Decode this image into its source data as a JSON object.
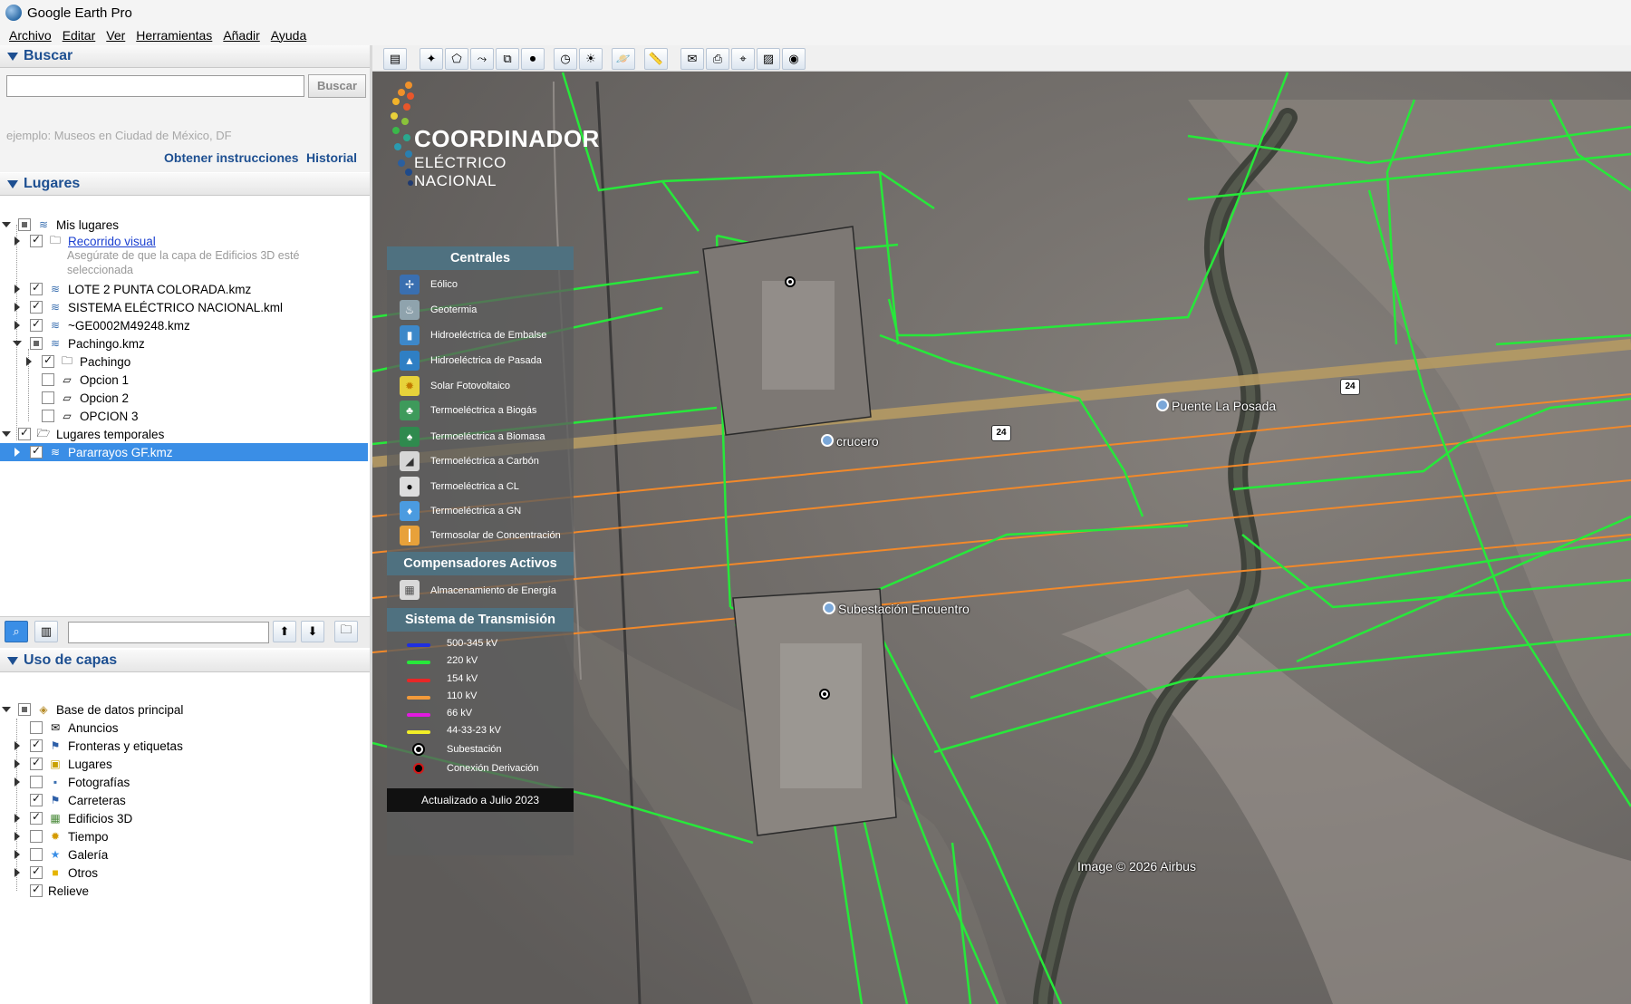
{
  "window": {
    "title": "Google Earth Pro"
  },
  "menu": [
    "Archivo",
    "Editar",
    "Ver",
    "Herramientas",
    "Añadir",
    "Ayuda"
  ],
  "search": {
    "header": "Buscar",
    "input_value": "",
    "button": "Buscar",
    "hint": "ejemplo: Museos en Ciudad de México, DF",
    "directions": "Obtener instrucciones",
    "history": "Historial"
  },
  "places": {
    "header": "Lugares",
    "items": [
      {
        "label": "Mis lugares"
      },
      {
        "label": "Recorrido visual"
      },
      {
        "label": "Asegúrate de que la capa de Edificios 3D esté"
      },
      {
        "label": "seleccionada"
      },
      {
        "label": "LOTE 2 PUNTA COLORADA.kmz"
      },
      {
        "label": "SISTEMA ELÉCTRICO NACIONAL.kml"
      },
      {
        "label": "~GE0002M49248.kmz"
      },
      {
        "label": "Pachingo.kmz"
      },
      {
        "label": "Pachingo"
      },
      {
        "label": "Opcion 1"
      },
      {
        "label": "Opcion 2"
      },
      {
        "label": "OPCION 3"
      },
      {
        "label": "Lugares temporales"
      },
      {
        "label": "Pararrayos GF.kmz"
      }
    ]
  },
  "layers": {
    "header": "Uso de capas",
    "items": [
      {
        "label": "Base de datos principal"
      },
      {
        "label": "Anuncios"
      },
      {
        "label": "Fronteras y etiquetas"
      },
      {
        "label": "Lugares"
      },
      {
        "label": "Fotografías"
      },
      {
        "label": "Carreteras"
      },
      {
        "label": "Edificios 3D"
      },
      {
        "label": "Tiempo"
      },
      {
        "label": "Galería"
      },
      {
        "label": "Otros"
      },
      {
        "label": "Relieve"
      }
    ]
  },
  "legend": {
    "logo_line1": "COORDINADOR",
    "logo_line2": "ELÉCTRICO NACIONAL",
    "centrales_header": "Centrales",
    "centrales": [
      {
        "label": "Eólico",
        "color": "#3a6fb0"
      },
      {
        "label": "Geotermia",
        "color": "#8fa3ad"
      },
      {
        "label": "Hidroeléctrica de Embalse",
        "color": "#3d88c9"
      },
      {
        "label": "Hidroeléctrica de Pasada",
        "color": "#2f7fc4"
      },
      {
        "label": "Solar Fotovoltaico",
        "color": "#e7d23a"
      },
      {
        "label": "Termoeléctrica a Biogás",
        "color": "#3e9a5b"
      },
      {
        "label": "Termoeléctrica a Biomasa",
        "color": "#2f8a4e"
      },
      {
        "label": "Termoeléctrica a Carbón",
        "color": "#d6d6d6"
      },
      {
        "label": "Termoeléctrica a CL",
        "color": "#dddddd"
      },
      {
        "label": "Termoeléctrica a GN",
        "color": "#4b9be0"
      },
      {
        "label": "Termosolar de Concentración",
        "color": "#e8a13a"
      }
    ],
    "compensadores_header": "Compensadores Activos",
    "compensadores": [
      {
        "label": "Almacenamiento de Energía"
      }
    ],
    "transmision_header": "Sistema de Transmisión",
    "transmision": [
      {
        "label": "500-345 kV",
        "color": "#1f2fe0"
      },
      {
        "label": "220 kV",
        "color": "#27e83a"
      },
      {
        "label": "154 kV",
        "color": "#e82727"
      },
      {
        "label": "110 kV",
        "color": "#f29a3a"
      },
      {
        "label": "66 kV",
        "color": "#e21ae0"
      },
      {
        "label": "44-33-23 kV",
        "color": "#f2ee27"
      },
      {
        "label": "Subestación",
        "color": "#ffffff"
      },
      {
        "label": "Conexión Derivación",
        "color": "#d21a1a"
      }
    ],
    "updated": "Actualizado a Julio 2023"
  },
  "map_labels": {
    "puente": "Puente La Posada",
    "crucero": "crucero",
    "subestacion": "Subestación Encuentro",
    "route1": "24",
    "route2": "24",
    "credit": "Image © 2026 Airbus"
  }
}
